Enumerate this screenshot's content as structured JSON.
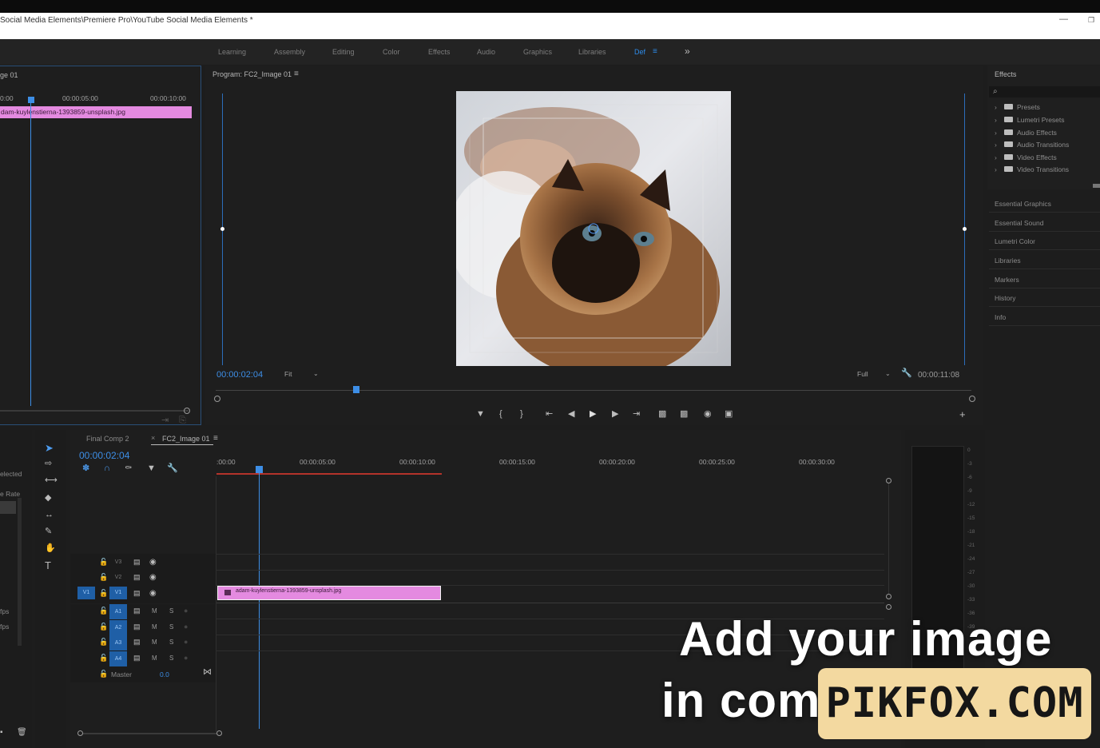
{
  "window": {
    "title": "Social Media Elements\\Premiere Pro\\YouTube Social Media Elements *",
    "minimize": "—",
    "restore": "❐"
  },
  "workspaces": {
    "tabs": [
      "Learning",
      "Assembly",
      "Editing",
      "Color",
      "Effects",
      "Audio",
      "Graphics",
      "Libraries",
      "Def"
    ],
    "active_index": 8,
    "menu_glyph": "≡",
    "more_glyph": "»"
  },
  "source_panel": {
    "title": "ge 01",
    "timecodes": [
      "0:00",
      "00:00:05:00",
      "00:00:10:00"
    ],
    "clip_name": "dam-kuylenstierna-1393859-unsplash.jpg"
  },
  "program_monitor": {
    "title": "Program: FC2_Image 01",
    "menu_glyph": "≡",
    "current_time": "00:00:02:04",
    "fit": "Fit",
    "quality": "Full",
    "duration": "00:00:11:08"
  },
  "effects_panel": {
    "title": "Effects",
    "search_glyph": "⌕",
    "items": [
      "Presets",
      "Lumetri Presets",
      "Audio Effects",
      "Audio Transitions",
      "Video Effects",
      "Video Transitions"
    ]
  },
  "side_panels": [
    "Essential Graphics",
    "Essential Sound",
    "Lumetri Color",
    "Libraries",
    "Markers",
    "History",
    "Info"
  ],
  "project_fragment": {
    "labels": [
      "elected",
      "e Rate",
      "fps",
      "fps"
    ]
  },
  "timeline": {
    "tabs": [
      "Final Comp 2",
      "FC2_Image 01"
    ],
    "close_glyph": "×",
    "menu_glyph": "≡",
    "current_time": "00:00:02:04",
    "ruler": [
      ":00:00",
      "00:00:05:00",
      "00:00:10:00",
      "00:00:15:00",
      "00:00:20:00",
      "00:00:25:00",
      "00:00:30:00"
    ],
    "video_tracks": [
      "V3",
      "V2",
      "V1"
    ],
    "audio_tracks": [
      "A1",
      "A2",
      "A3",
      "A4"
    ],
    "source_patch": "V1",
    "mute": "M",
    "solo": "S",
    "master": "Master",
    "master_value": "0.0",
    "clip_name": "adam-kuylenstierna-1393859-unsplash.jpg"
  },
  "meter_scale": [
    "0",
    "-3",
    "-6",
    "-9",
    "-12",
    "-15",
    "-18",
    "-21",
    "-24",
    "-27",
    "-30",
    "-33",
    "-36",
    "-39"
  ],
  "overlay": {
    "line1": "Add your image",
    "line2": "in com",
    "watermark": "PIKFOX.COM"
  },
  "colors": {
    "accent_blue": "#2d8ceb",
    "clip_pink": "#e48ae0",
    "watermark_bg": "#f3d9a0"
  }
}
